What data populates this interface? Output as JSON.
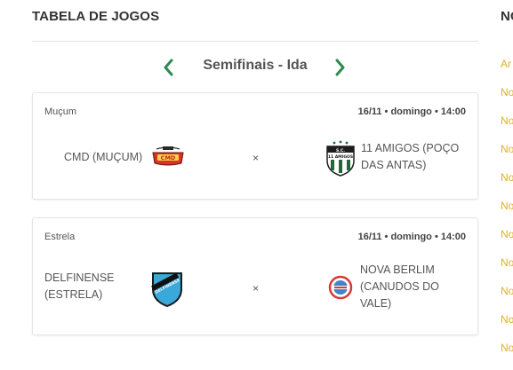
{
  "section": {
    "title": "TABELA DE JOGOS"
  },
  "round": {
    "label": "Semifinais - Ida"
  },
  "matches": [
    {
      "venue": "Muçum",
      "datetime": "16/11 • domingo • 14:00",
      "home": "CMD (MUÇUM)",
      "away": "11 AMIGOS (POÇO DAS ANTAS)",
      "separator": "×"
    },
    {
      "venue": "Estrela",
      "datetime": "16/11 • domingo • 14:00",
      "home": "DELFINENSE (ESTRELA)",
      "away": "NOVA BERLIM (CANUDOS DO VALE)",
      "separator": "×"
    }
  ],
  "sidebar": {
    "title": "NO",
    "links": [
      "Ar",
      "No",
      "No",
      "No",
      "No",
      "No",
      "No",
      "No",
      "No",
      "No",
      "No"
    ]
  },
  "colors": {
    "arrow": "#2d8a4e",
    "link": "#d9b227"
  }
}
